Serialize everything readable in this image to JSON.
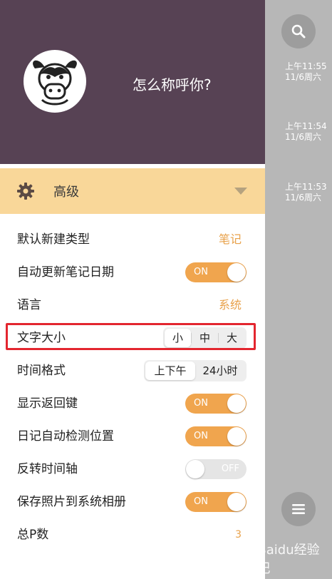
{
  "background_list": {
    "timestamps": [
      {
        "time": "上午11:55",
        "date": "11/6周六"
      },
      {
        "time": "上午11:54",
        "date": "11/6周六"
      },
      {
        "time": "上午11:53",
        "date": "11/6周六"
      }
    ],
    "watermark": "Baidu经验 记"
  },
  "profile": {
    "name_prompt": "怎么称呼你?"
  },
  "advanced": {
    "title": "高级"
  },
  "settings": {
    "default_type": {
      "label": "默认新建类型",
      "value": "笔记"
    },
    "auto_update_date": {
      "label": "自动更新笔记日期",
      "state": "ON"
    },
    "language": {
      "label": "语言",
      "value": "系统"
    },
    "font_size": {
      "label": "文字大小",
      "options": [
        "小",
        "中",
        "大"
      ],
      "selected": "小"
    },
    "time_format": {
      "label": "时间格式",
      "options": [
        "上下午",
        "24小时"
      ],
      "selected": "上下午"
    },
    "show_back_key": {
      "label": "显示返回键",
      "state": "ON"
    },
    "diary_location": {
      "label": "日记自动检测位置",
      "state": "ON"
    },
    "reverse_timeline": {
      "label": "反转时间轴",
      "state": "OFF"
    },
    "save_photos": {
      "label": "保存照片到系统相册",
      "state": "ON"
    },
    "total_p": {
      "label": "总P数",
      "value": "3"
    }
  },
  "colors": {
    "profile_bg": "#574254",
    "accent": "#f0a54e",
    "advanced_bar": "#f9d799",
    "highlight": "#e3262f"
  }
}
